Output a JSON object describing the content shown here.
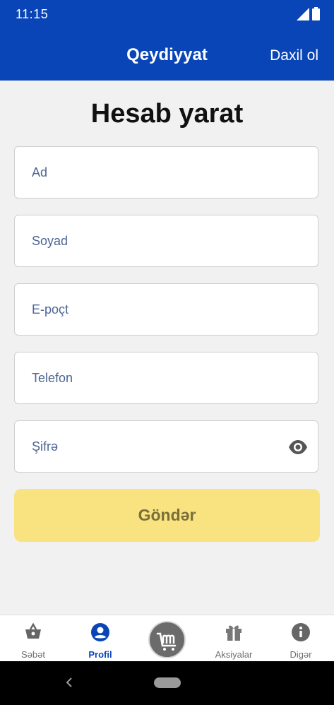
{
  "status_bar": {
    "time": "11:15"
  },
  "app_bar": {
    "title": "Qeydiyyat",
    "action_label": "Daxil ol"
  },
  "form": {
    "title": "Hesab yarat",
    "fields": {
      "first_name_placeholder": "Ad",
      "last_name_placeholder": "Soyad",
      "email_placeholder": "E-poçt",
      "phone_placeholder": "Telefon",
      "password_placeholder": "Şifrə"
    },
    "submit_label": "Göndər"
  },
  "bottom_nav": {
    "items": [
      {
        "label": "Səbət",
        "icon": "basket-icon"
      },
      {
        "label": "Profil",
        "icon": "profile-icon",
        "active": true
      },
      {
        "label": "",
        "icon": "store-logo-icon"
      },
      {
        "label": "Aksiyalar",
        "icon": "gift-icon"
      },
      {
        "label": "Digər",
        "icon": "info-icon"
      }
    ]
  },
  "colors": {
    "primary": "#0a45b7",
    "submit_bg": "#f8e380",
    "background": "#f1f1f1"
  }
}
